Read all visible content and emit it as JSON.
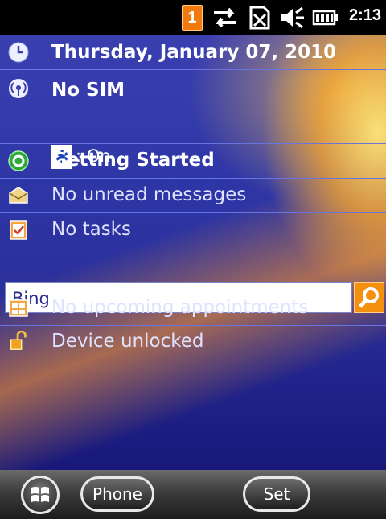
{
  "status_bar": {
    "notification_count": "1",
    "time": "2:13",
    "icons": [
      "notification-badge",
      "sync-arrows-icon",
      "no-sim-icon",
      "speaker-muted-icon",
      "battery-icon"
    ]
  },
  "today": {
    "date": "Thursday, January 07, 2010",
    "carrier": "No SIM",
    "bluetooth_status": ": On",
    "getting_started": "Getting Started",
    "messages": "No unread messages",
    "tasks": "No tasks",
    "search": {
      "value": "Bing"
    },
    "appointments": "No upcoming appointments",
    "device_lock": "Device unlocked"
  },
  "softkeys": {
    "left": "Phone",
    "right": "Set"
  },
  "colors": {
    "accent_orange": "#f5900f",
    "background_blue": "#2e36a6"
  }
}
